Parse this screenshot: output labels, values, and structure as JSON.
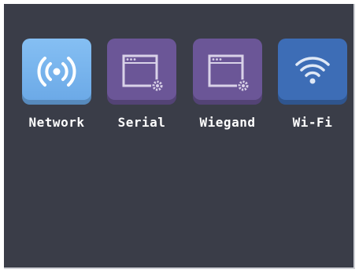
{
  "colors": {
    "background": "#3a3d48",
    "network_tile": "#7ab4ee",
    "serial_tile": "#6b5697",
    "wiegand_tile": "#6b5697",
    "wifi_tile": "#3d6db6",
    "label_text": "#ffffff"
  },
  "menu": {
    "items": [
      {
        "label": "Network",
        "icon": "network-broadcast-icon"
      },
      {
        "label": "Serial",
        "icon": "window-settings-icon"
      },
      {
        "label": "Wiegand",
        "icon": "window-settings-icon"
      },
      {
        "label": "Wi-Fi",
        "icon": "wifi-icon"
      }
    ]
  }
}
